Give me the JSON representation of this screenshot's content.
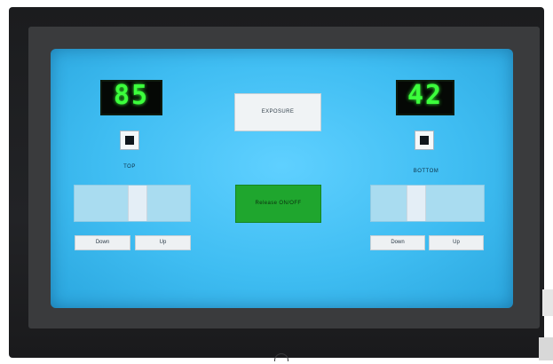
{
  "top_axis": {
    "display_value": "85",
    "label": "TOP",
    "down_label": "Down",
    "up_label": "Up",
    "slider_position": 0.56
  },
  "bottom_axis": {
    "display_value": "42",
    "label": "BOTTOM",
    "down_label": "Down",
    "up_label": "Up",
    "slider_position": 0.38
  },
  "controls": {
    "exposure_label": "EXPOSURE",
    "release_label": "Release ON/OFF"
  },
  "colors": {
    "screen_background": "#3fbdf2",
    "display_digits": "#3cff3c",
    "release_button": "#1fa62e"
  },
  "icons": {
    "indicator": "status-square"
  }
}
